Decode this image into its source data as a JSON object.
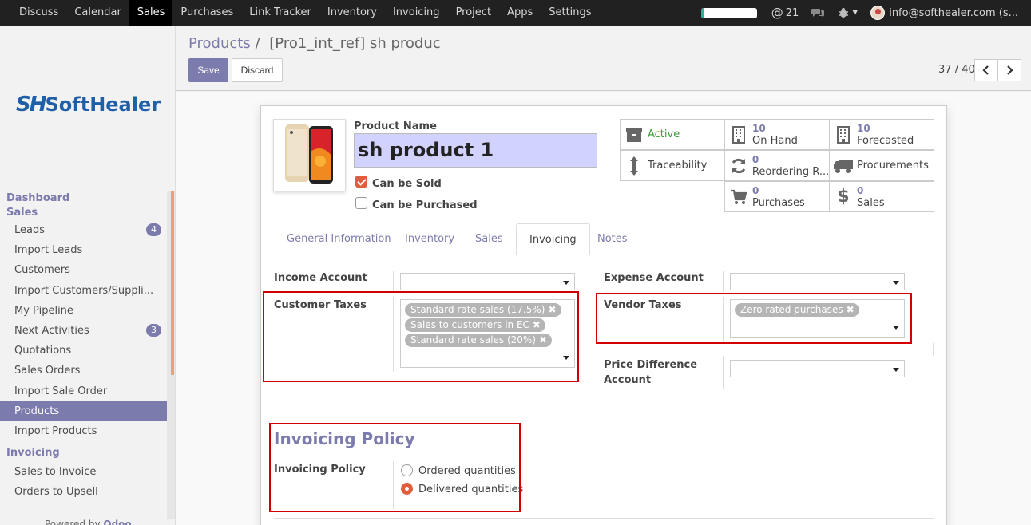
{
  "topbar": {
    "menu": [
      "Discuss",
      "Calendar",
      "Sales",
      "Purchases",
      "Link Tracker",
      "Inventory",
      "Invoicing",
      "Project",
      "Apps",
      "Settings"
    ],
    "active_menu": "Sales",
    "progress_fraction": 0.05,
    "mentions_count": "21",
    "user_email": "info@softhealer.com (s..."
  },
  "sidebar": {
    "logo_mark": "SH",
    "logo_text": "SoftHealer",
    "dashboard_header": "Dashboard",
    "sales_header": "Sales",
    "sales_items": [
      {
        "label": "Leads",
        "badge": "4"
      },
      {
        "label": "Import Leads"
      },
      {
        "label": "Customers"
      },
      {
        "label": "Import Customers/Suppli..."
      },
      {
        "label": "My Pipeline"
      },
      {
        "label": "Next Activities",
        "badge": "3"
      },
      {
        "label": "Quotations"
      },
      {
        "label": "Sales Orders"
      },
      {
        "label": "Import Sale Order"
      },
      {
        "label": "Products",
        "active": true
      },
      {
        "label": "Import Products"
      }
    ],
    "invoicing_header": "Invoicing",
    "invoicing_items": [
      {
        "label": "Sales to Invoice"
      },
      {
        "label": "Orders to Upsell"
      }
    ],
    "powered_prefix": "Powered by",
    "powered_brand": "Odoo"
  },
  "control": {
    "breadcrumb_parent": "Products",
    "breadcrumb_sep": "/",
    "breadcrumb_current": "[Pro1_int_ref] sh produc",
    "save_label": "Save",
    "discard_label": "Discard",
    "pager": "37 / 40"
  },
  "product": {
    "name_label": "Product Name",
    "name": "sh product 1",
    "can_be_sold_label": "Can be Sold",
    "can_be_sold": true,
    "can_be_purchased_label": "Can be Purchased",
    "can_be_purchased": false
  },
  "smart_buttons": {
    "active": "Active",
    "traceability": "Traceability",
    "on_hand_count": "10",
    "on_hand": "On Hand",
    "forecasted_count": "10",
    "forecasted": "Forecasted",
    "reordering_count": "0",
    "reordering": "Reordering R...",
    "procurements": "Procurements",
    "purchases_count": "0",
    "purchases": "Purchases",
    "sales_count": "0",
    "sales": "Sales"
  },
  "tabs": [
    "General Information",
    "Inventory",
    "Sales",
    "Invoicing",
    "Notes"
  ],
  "active_tab": "Invoicing",
  "invoicing": {
    "income_account_label": "Income Account",
    "customer_taxes_label": "Customer Taxes",
    "customer_taxes": [
      "Standard rate sales (17.5%)",
      "Sales to customers in EC",
      "Standard rate sales (20%)"
    ],
    "expense_account_label": "Expense Account",
    "vendor_taxes_label": "Vendor Taxes",
    "vendor_taxes": [
      "Zero rated purchases"
    ],
    "price_diff_label_1": "Price Difference",
    "price_diff_label_2": "Account",
    "policy_section": "Invoicing Policy",
    "policy_label": "Invoicing Policy",
    "policy_options": [
      "Ordered quantities",
      "Delivered quantities"
    ],
    "policy_selected": "Delivered quantities"
  },
  "colors": {
    "brand": "#7c7bad",
    "accent_check": "#e05e3c",
    "highlight_red": "#d20000",
    "active_green": "#3a9b3a"
  }
}
